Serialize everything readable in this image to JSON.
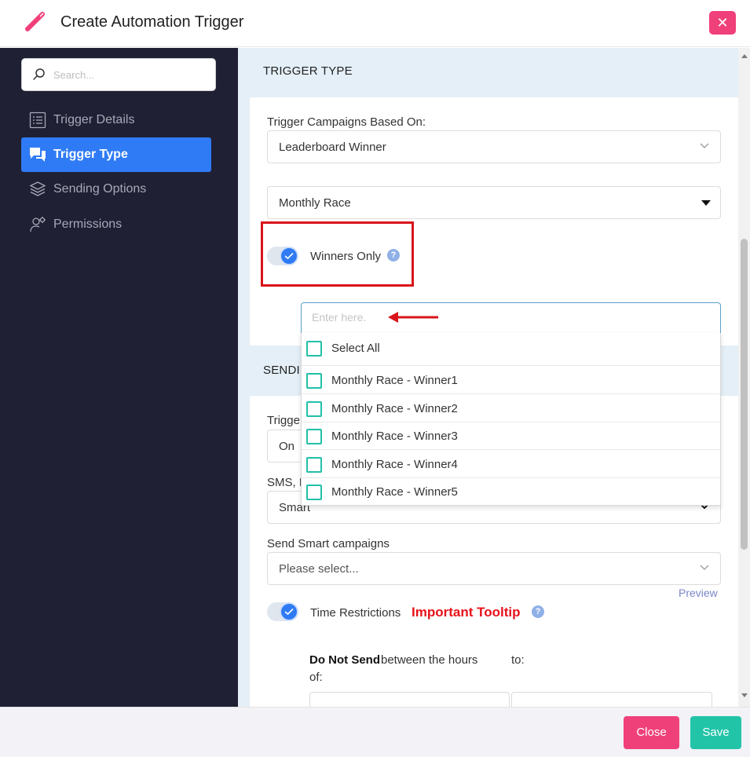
{
  "header": {
    "title": "Create Automation Trigger",
    "close_glyph": "✕"
  },
  "sidebar": {
    "search_placeholder": "Search...",
    "items": [
      {
        "label": "Trigger Details",
        "icon": "list-icon"
      },
      {
        "label": "Trigger Type",
        "icon": "chat-icon",
        "active": true
      },
      {
        "label": "Sending Options",
        "icon": "layers-icon"
      },
      {
        "label": "Permissions",
        "icon": "user-cog-icon"
      }
    ]
  },
  "trigger_type": {
    "heading": "TRIGGER TYPE",
    "based_on_label": "Trigger Campaigns Based On:",
    "based_on_value": "Leaderboard Winner",
    "race_value": "Monthly Race",
    "winners_only_label": "Winners Only",
    "help_glyph": "?"
  },
  "winners_dropdown": {
    "placeholder": "Enter here.",
    "select_all": "Select All",
    "options": [
      "Monthly Race - Winner1",
      "Monthly Race - Winner2",
      "Monthly Race - Winner3",
      "Monthly Race - Winner4",
      "Monthly Race - Winner5"
    ]
  },
  "sending": {
    "heading_partial": "SENDIN",
    "trigger_label_partial": "Trigge",
    "trigger_value_partial": "On",
    "channel_label_partial": "SMS, E",
    "channel_value_partial": "Smart",
    "smart_label": "Send Smart campaigns",
    "smart_placeholder": "Please select...",
    "preview": "Preview",
    "time_label": "Time Restrictions",
    "tooltip_label": "Important Tooltip",
    "do_not_send_bold": "Do Not Send",
    "do_not_send_rest": "between the hours",
    "of": "of:",
    "to": "to:"
  },
  "footer": {
    "close": "Close",
    "save": "Save"
  },
  "colors": {
    "accent_blue": "#2f7bf5",
    "pink": "#f0407a",
    "teal": "#22c4a8",
    "sidebar_bg": "#1f2033",
    "annotation_red": "#d9151b"
  }
}
